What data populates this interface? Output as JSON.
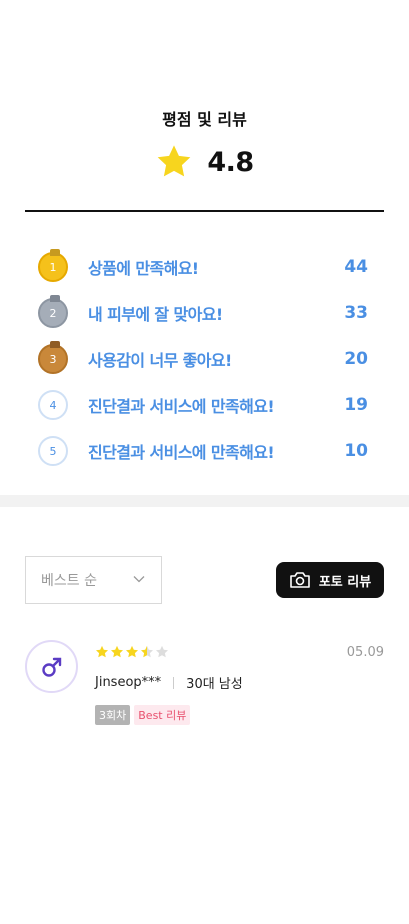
{
  "summary": {
    "title": "평점 및 리뷰",
    "rating": "4.8"
  },
  "keywords": [
    {
      "rank": "1",
      "label": "상품에 만족해요!",
      "count": "44",
      "medal": "gold"
    },
    {
      "rank": "2",
      "label": "내 피부에 잘 맞아요!",
      "count": "33",
      "medal": "silver"
    },
    {
      "rank": "3",
      "label": "사용감이 너무 좋아요!",
      "count": "20",
      "medal": "bronze"
    },
    {
      "rank": "4",
      "label": "진단결과 서비스에 만족해요!",
      "count": "19",
      "medal": "plain"
    },
    {
      "rank": "5",
      "label": "진단결과 서비스에 만족해요!",
      "count": "10",
      "medal": "plain"
    }
  ],
  "controls": {
    "sort_selected": "베스트 순",
    "photo_review_label": "포토 리뷰"
  },
  "review": {
    "rating": 3.5,
    "date": "05.09",
    "author": "Jinseop***",
    "demographic": "30대 남성",
    "visit_badge": "3회차",
    "best_badge": "Best 리뷰",
    "avatar_icon": "male-symbol-icon"
  },
  "colors": {
    "accent_blue": "#4a8fe3",
    "star_yellow": "#f7d51e",
    "best_pink": "#e8506e",
    "avatar_purple": "#5b3cc4"
  }
}
